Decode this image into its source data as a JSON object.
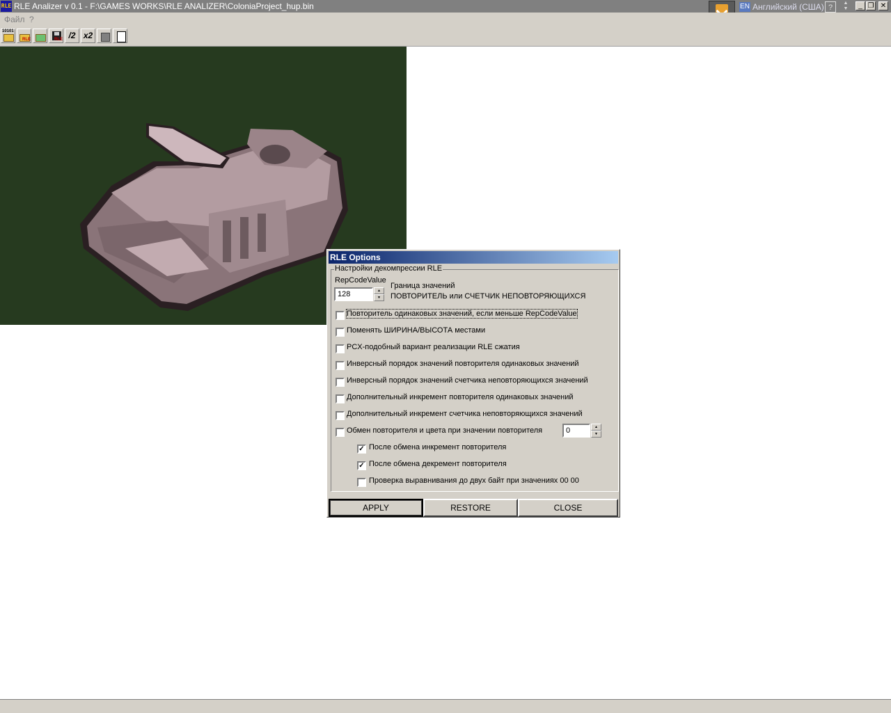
{
  "window": {
    "title": "RLE Analizer v 0.1 - F:\\GAMES WORKS\\RLE ANALIZER\\ColoniaProject_hup.bin",
    "icon_label": "RLE",
    "language_code": "EN",
    "language_name": "Английский (США)",
    "help_tray": "?"
  },
  "menu": {
    "file": "Файл",
    "help": "?"
  },
  "toolbar": {
    "open_bin_tag": "10101",
    "open_rle_tag": "RLE",
    "save_tag": "RLE",
    "half_label": "/2",
    "double_label": "x2"
  },
  "dialog": {
    "title": "RLE Options",
    "group_label": "Настройки декомпрессии RLE",
    "repcode_label": "RepCodeValue",
    "repcode_value": "128",
    "bound_title": "Граница значений",
    "bound_desc": "ПОВТОРИТЕЛЬ или СЧЕТЧИК НЕПОВТОРЯЮЩИХСЯ",
    "options": [
      {
        "label": "Повторитель одинаковых значений, если меньше RepCodeValue",
        "checked": false
      },
      {
        "label": "Поменять ШИРИНА/ВЫСОТА местами",
        "checked": false
      },
      {
        "label": "PCX-подобный вариант реализации RLE сжатия",
        "checked": false
      },
      {
        "label": "Инверсный порядок значений повторителя одинаковых значений",
        "checked": false
      },
      {
        "label": "Инверсный порядок значений счетчика неповторяющихся значений",
        "checked": false
      },
      {
        "label": "Дополнительный инкремент повторителя одинаковых значений",
        "checked": false
      },
      {
        "label": "Дополнительный инкремент счетчика неповторяющихся значений",
        "checked": false
      },
      {
        "label": "Обмен повторителя и цвета при значении повторителя",
        "checked": false
      }
    ],
    "swap_value": "0",
    "sub_options": [
      {
        "label": "После обмена инкремент повторителя",
        "checked": true
      },
      {
        "label": "После обмена декремент повторителя",
        "checked": true
      },
      {
        "label": "Проверка выравнивания до двух байт при значениях 00 00",
        "checked": false
      }
    ],
    "check_mark": "✓",
    "apply_label": "APPLY",
    "restore_label": "RESTORE",
    "close_label": "CLOSE"
  }
}
